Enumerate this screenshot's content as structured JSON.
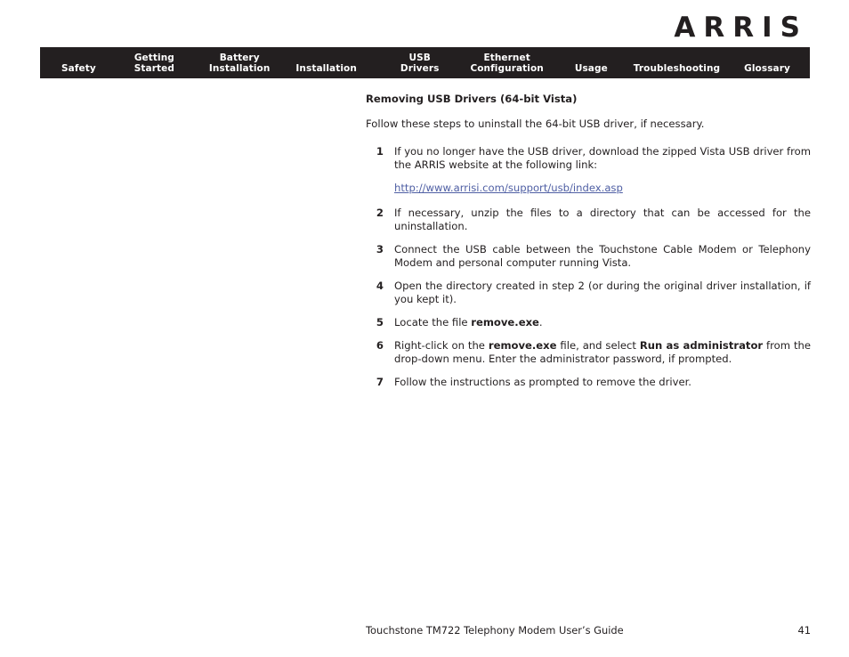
{
  "brand": {
    "logo_text": "ARRIS"
  },
  "nav": {
    "items": [
      {
        "label": "Safety",
        "name": "safety"
      },
      {
        "label": "Getting\nStarted",
        "name": "getting-started"
      },
      {
        "label": "Battery\nInstallation",
        "name": "battery-installation"
      },
      {
        "label": "Installation",
        "name": "installation"
      },
      {
        "label": "USB\nDrivers",
        "name": "usb-drivers"
      },
      {
        "label": "Ethernet\nConfiguration",
        "name": "ethernet-configuration"
      },
      {
        "label": "Usage",
        "name": "usage"
      },
      {
        "label": "Troubleshooting",
        "name": "troubleshooting"
      },
      {
        "label": "Glossary",
        "name": "glossary"
      }
    ]
  },
  "main": {
    "heading": "Removing USB Drivers (64-bit Vista)",
    "intro": "Follow these steps to uninstall the 64-bit USB driver, if necessary.",
    "steps": [
      {
        "number": "1",
        "text": "If you no longer have the USB driver, download the zipped Vista USB driver from the ARRIS website at the following link:",
        "link": "http://www.arrisi.com/support/usb/index.asp"
      },
      {
        "number": "2",
        "text": "If necessary, unzip the files to a directory that can be accessed for the uninstallation."
      },
      {
        "number": "3",
        "text": "Connect the USB cable between the Touchstone Cable Modem or Telephony Modem and personal computer running Vista."
      },
      {
        "number": "4",
        "text": "Open the directory created in step 2 (or during the original driver installation, if you kept it)."
      },
      {
        "number": "5",
        "text_before": "Locate the file ",
        "bold1": "remove.exe",
        "text_after": "."
      },
      {
        "number": "6",
        "text_before": "Right-click on the ",
        "bold1": "remove.exe",
        "text_mid": " file, and select ",
        "bold2": "Run as administrator",
        "text_after": " from the drop-down menu. Enter the administrator password, if prompted."
      },
      {
        "number": "7",
        "text": "Follow the instructions as prompted to remove the driver."
      }
    ]
  },
  "footer": {
    "title": "Touchstone TM722 Telephony Modem User’s Guide",
    "page_number": "41"
  },
  "colors": {
    "nav_background": "#231f20",
    "text": "#231f20",
    "link": "#4f5fa4",
    "page_background": "#ffffff"
  }
}
